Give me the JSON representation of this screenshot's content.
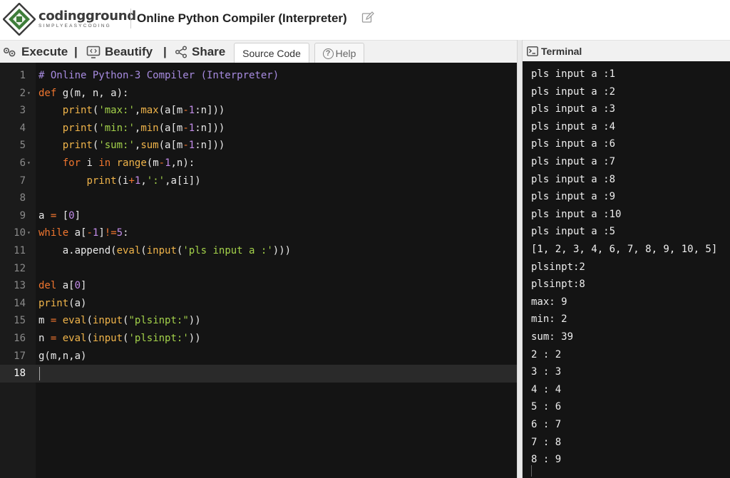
{
  "brand": {
    "name": "codingground",
    "tagline": "SIMPLYEASYCODING"
  },
  "page": {
    "title": "Online Python Compiler (Interpreter)"
  },
  "toolbar": {
    "execute_label": "Execute",
    "beautify_label": "Beautify",
    "share_label": "Share",
    "separator": "|",
    "tabs": [
      {
        "label": "Source Code",
        "active": true
      },
      {
        "label": "Help",
        "active": false
      }
    ]
  },
  "editor": {
    "current_line": 18,
    "lines": [
      {
        "n": "1",
        "fold": false,
        "tokens": [
          [
            "c",
            "# Online Python-3 Compiler (Interpreter)"
          ]
        ]
      },
      {
        "n": "2",
        "fold": true,
        "tokens": [
          [
            "k",
            "def"
          ],
          [
            "p",
            " g(m, n, a):"
          ]
        ]
      },
      {
        "n": "3",
        "fold": false,
        "tokens": [
          [
            "p",
            "    "
          ],
          [
            "f",
            "print"
          ],
          [
            "p",
            "("
          ],
          [
            "s",
            "'max:'"
          ],
          [
            "p",
            ","
          ],
          [
            "f",
            "max"
          ],
          [
            "p",
            "(a[m"
          ],
          [
            "o",
            "-"
          ],
          [
            "d",
            "1"
          ],
          [
            "p",
            ":n]))"
          ]
        ]
      },
      {
        "n": "4",
        "fold": false,
        "tokens": [
          [
            "p",
            "    "
          ],
          [
            "f",
            "print"
          ],
          [
            "p",
            "("
          ],
          [
            "s",
            "'min:'"
          ],
          [
            "p",
            ","
          ],
          [
            "f",
            "min"
          ],
          [
            "p",
            "(a[m"
          ],
          [
            "o",
            "-"
          ],
          [
            "d",
            "1"
          ],
          [
            "p",
            ":n]))"
          ]
        ]
      },
      {
        "n": "5",
        "fold": false,
        "tokens": [
          [
            "p",
            "    "
          ],
          [
            "f",
            "print"
          ],
          [
            "p",
            "("
          ],
          [
            "s",
            "'sum:'"
          ],
          [
            "p",
            ","
          ],
          [
            "f",
            "sum"
          ],
          [
            "p",
            "(a[m"
          ],
          [
            "o",
            "-"
          ],
          [
            "d",
            "1"
          ],
          [
            "p",
            ":n]))"
          ]
        ]
      },
      {
        "n": "6",
        "fold": true,
        "tokens": [
          [
            "p",
            "    "
          ],
          [
            "k",
            "for"
          ],
          [
            "p",
            " i "
          ],
          [
            "k",
            "in"
          ],
          [
            "p",
            " "
          ],
          [
            "f",
            "range"
          ],
          [
            "p",
            "(m"
          ],
          [
            "o",
            "-"
          ],
          [
            "d",
            "1"
          ],
          [
            "p",
            ",n):"
          ]
        ]
      },
      {
        "n": "7",
        "fold": false,
        "tokens": [
          [
            "p",
            "        "
          ],
          [
            "f",
            "print"
          ],
          [
            "p",
            "(i"
          ],
          [
            "o",
            "+"
          ],
          [
            "d",
            "1"
          ],
          [
            "p",
            ","
          ],
          [
            "s",
            "':'"
          ],
          [
            "p",
            ",a[i])"
          ]
        ]
      },
      {
        "n": "8",
        "fold": false,
        "tokens": []
      },
      {
        "n": "9",
        "fold": false,
        "tokens": [
          [
            "p",
            "a "
          ],
          [
            "o",
            "="
          ],
          [
            "p",
            " ["
          ],
          [
            "d",
            "0"
          ],
          [
            "p",
            "]"
          ]
        ]
      },
      {
        "n": "10",
        "fold": true,
        "tokens": [
          [
            "k",
            "while"
          ],
          [
            "p",
            " a["
          ],
          [
            "o",
            "-"
          ],
          [
            "d",
            "1"
          ],
          [
            "p",
            "]"
          ],
          [
            "o",
            "!="
          ],
          [
            "d",
            "5"
          ],
          [
            "p",
            ":"
          ]
        ]
      },
      {
        "n": "11",
        "fold": false,
        "tokens": [
          [
            "p",
            "    a.append("
          ],
          [
            "f",
            "eval"
          ],
          [
            "p",
            "("
          ],
          [
            "f",
            "input"
          ],
          [
            "p",
            "("
          ],
          [
            "s",
            "'pls input a :'"
          ],
          [
            "p",
            ")))"
          ]
        ]
      },
      {
        "n": "12",
        "fold": false,
        "tokens": []
      },
      {
        "n": "13",
        "fold": false,
        "tokens": [
          [
            "k",
            "del"
          ],
          [
            "p",
            " a["
          ],
          [
            "d",
            "0"
          ],
          [
            "p",
            "]"
          ]
        ]
      },
      {
        "n": "14",
        "fold": false,
        "tokens": [
          [
            "f",
            "print"
          ],
          [
            "p",
            "(a)"
          ]
        ]
      },
      {
        "n": "15",
        "fold": false,
        "tokens": [
          [
            "p",
            "m "
          ],
          [
            "o",
            "="
          ],
          [
            "p",
            " "
          ],
          [
            "f",
            "eval"
          ],
          [
            "p",
            "("
          ],
          [
            "f",
            "input"
          ],
          [
            "p",
            "("
          ],
          [
            "s",
            "\"plsinpt:\""
          ],
          [
            "p",
            "))"
          ]
        ]
      },
      {
        "n": "16",
        "fold": false,
        "tokens": [
          [
            "p",
            "n "
          ],
          [
            "o",
            "="
          ],
          [
            "p",
            " "
          ],
          [
            "f",
            "eval"
          ],
          [
            "p",
            "("
          ],
          [
            "f",
            "input"
          ],
          [
            "p",
            "("
          ],
          [
            "s",
            "'plsinpt:'"
          ],
          [
            "p",
            "))"
          ]
        ]
      },
      {
        "n": "17",
        "fold": false,
        "tokens": [
          [
            "p",
            "g(m,n,a)"
          ]
        ]
      },
      {
        "n": "18",
        "fold": false,
        "tokens": []
      }
    ]
  },
  "terminal": {
    "title": "Terminal",
    "output": [
      "pls input a :1",
      "pls input a :2",
      "pls input a :3",
      "pls input a :4",
      "pls input a :6",
      "pls input a :7",
      "pls input a :8",
      "pls input a :9",
      "pls input a :10",
      "pls input a :5",
      "[1, 2, 3, 4, 6, 7, 8, 9, 10, 5]",
      "plsinpt:2",
      "plsinpt:8",
      "max: 9",
      "min: 2",
      "sum: 39",
      "2 : 2",
      "3 : 3",
      "4 : 4",
      "5 : 6",
      "6 : 7",
      "7 : 8",
      "8 : 9"
    ]
  },
  "colors": {
    "editor_bg": "#141414",
    "comment": "#a78be0",
    "keyword": "#f0762f",
    "function": "#f0b44a",
    "string": "#a3d14a",
    "number": "#c28ce8"
  },
  "icons": [
    "logo-icon",
    "edit-icon",
    "execute-gear-icon",
    "beautify-icon",
    "share-icon",
    "help-icon",
    "terminal-icon"
  ]
}
